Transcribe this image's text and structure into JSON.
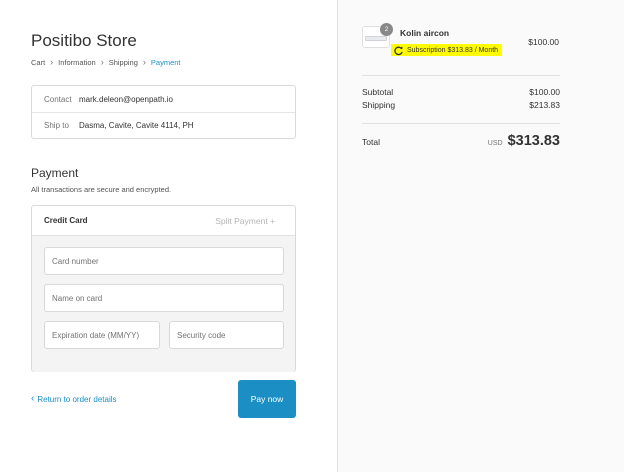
{
  "store": {
    "title": "Positibo Store"
  },
  "breadcrumb": {
    "items": [
      {
        "label": "Cart"
      },
      {
        "label": "Information"
      },
      {
        "label": "Shipping"
      },
      {
        "label": "Payment"
      }
    ],
    "separator": "›"
  },
  "info": {
    "contact_label": "Contact",
    "contact_value": "mark.deleon@openpath.io",
    "ship_label": "Ship to",
    "ship_value": "Dasma, Cavite, Cavite 4114, PH"
  },
  "payment": {
    "heading": "Payment",
    "subtext": "All transactions are secure and encrypted.",
    "tab_credit": "Credit Card",
    "tab_split": "Split Payment +",
    "card_number_placeholder": "Card number",
    "name_placeholder": "Name on card",
    "expiry_placeholder": "Expiration date (MM/YY)",
    "security_placeholder": "Security code",
    "return_label": "Return to order details",
    "return_chevron": "‹",
    "pay_button": "Pay now"
  },
  "order": {
    "product": {
      "name": "Kolin aircon",
      "quantity": "2",
      "subscription": "Subscription $313.83 / Month",
      "price": "$100.00",
      "icon": "refresh-icon"
    },
    "subtotal_label": "Subtotal",
    "subtotal_value": "$100.00",
    "shipping_label": "Shipping",
    "shipping_value": "$213.83",
    "total_label": "Total",
    "total_currency": "USD",
    "total_value": "$313.83"
  },
  "colors": {
    "accent": "#1b8fc4",
    "highlight": "#fffb00",
    "sidebar_bg": "#fafafa"
  }
}
